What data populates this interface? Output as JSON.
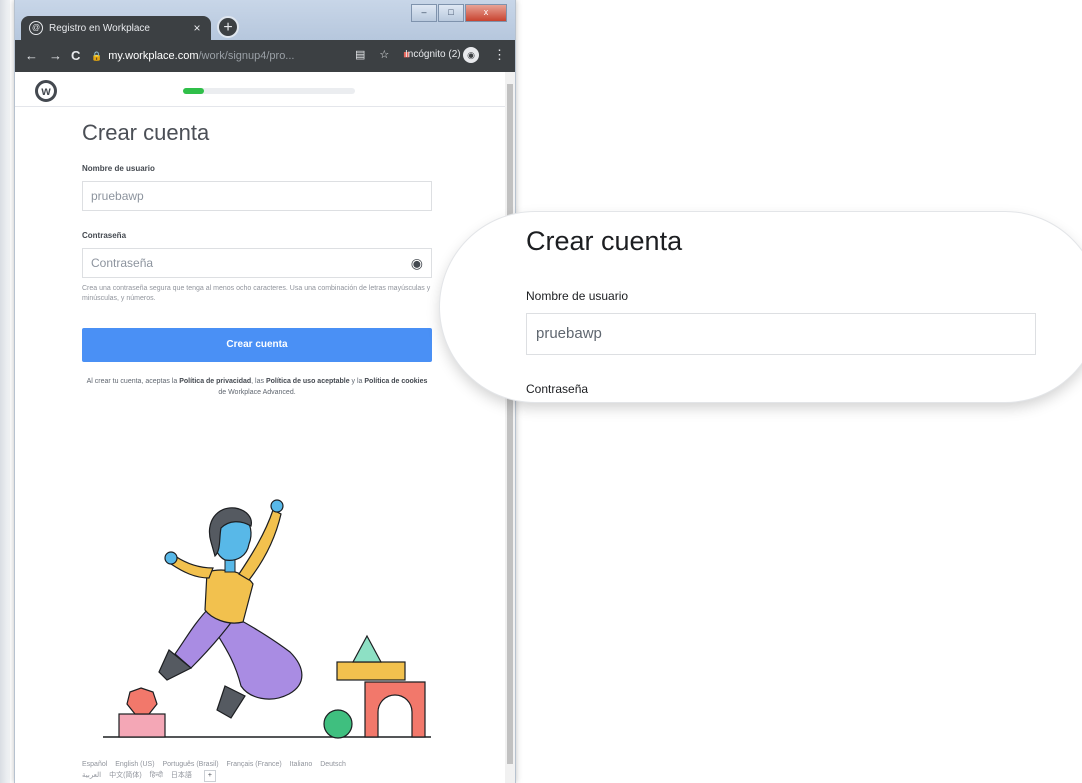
{
  "browser": {
    "tab_title": "Registro en Workplace",
    "tab_close": "×",
    "new_tab": "+",
    "url_host": "my.workplace.com",
    "url_path": "/work/signup4/pro...",
    "incognito_label": "Incógnito (2)",
    "nav_back": "←",
    "nav_forward": "→",
    "nav_reload": "C"
  },
  "page": {
    "progress_fraction": 0.12,
    "title": "Crear cuenta",
    "username_label": "Nombre de usuario",
    "username_value": "pruebawp",
    "password_label": "Contraseña",
    "password_placeholder": "Contraseña",
    "password_hint": "Crea una contraseña segura que tenga al menos ocho caracteres. Usa una combinación de letras mayúsculas y minúsculas, y números.",
    "submit_label": "Crear cuenta",
    "terms_prefix": "Al crear tu cuenta, aceptas la ",
    "terms_privacy": "Política de privacidad",
    "terms_mid1": ", las ",
    "terms_acceptable": "Política de uso aceptable",
    "terms_mid2": " y la ",
    "terms_cookies": "Política de cookies",
    "terms_suffix": " de Workplace Advanced."
  },
  "footer": {
    "current_language": "Español",
    "languages": [
      "English (US)",
      "Português (Brasil)",
      "Français (France)",
      "Italiano",
      "Deutsch"
    ],
    "languages_row2": [
      "العربية",
      "中文(简体)",
      "हिन्दी",
      "日本語"
    ],
    "more": "+"
  },
  "callout": {
    "title": "Crear cuenta",
    "username_label": "Nombre de usuario",
    "username_value": "pruebawp",
    "password_label": "Contraseña"
  },
  "colors": {
    "primary_button": "#4a90f5",
    "progress": "#2fbf49",
    "shirt": "#f2c14e",
    "pants": "#a98ce3",
    "skin": "#58b8e8"
  }
}
